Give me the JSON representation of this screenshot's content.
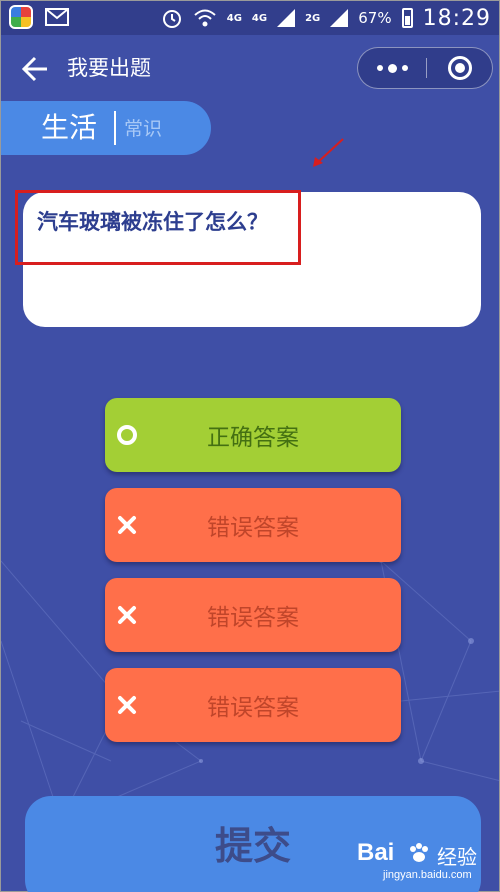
{
  "statusbar": {
    "network_1": "4G",
    "network_2": "4G",
    "network_3": "2G",
    "battery": "67%",
    "time": "18:29"
  },
  "nav": {
    "title": "我要出题"
  },
  "category": {
    "main": "生活",
    "sub": "常识"
  },
  "question": {
    "text": "汽车玻璃被冻住了怎么？"
  },
  "options": [
    {
      "label": "正确答案",
      "state": "correct",
      "icon": "circle-icon"
    },
    {
      "label": "错误答案",
      "state": "wrong",
      "icon": "cross-icon"
    },
    {
      "label": "错误答案",
      "state": "wrong",
      "icon": "cross-icon"
    },
    {
      "label": "错误答案",
      "state": "wrong",
      "icon": "cross-icon"
    }
  ],
  "submit": {
    "label": "提交"
  },
  "watermark": {
    "logo": "Bai",
    "text": "经验",
    "domain": "jingyan.baidu.com"
  },
  "colors": {
    "background": "#3f4fa6",
    "accent_blue": "#4b89e5",
    "correct": "#a3cf35",
    "wrong": "#ff6f4a",
    "highlight": "#d81e1e"
  }
}
